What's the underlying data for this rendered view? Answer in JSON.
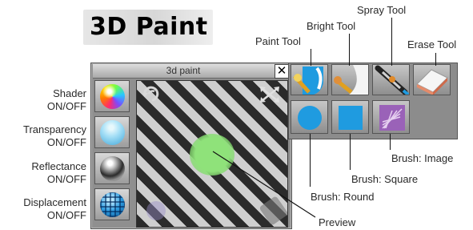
{
  "banner": {
    "title": "3D Paint"
  },
  "panel": {
    "title": "3d paint",
    "close_glyph": "✕"
  },
  "left_labels": [
    {
      "line1": "Shader",
      "line2": "ON/OFF"
    },
    {
      "line1": "Transparency",
      "line2": "ON/OFF"
    },
    {
      "line1": "Reflectance",
      "line2": "ON/OFF"
    },
    {
      "line1": "Displacement",
      "line2": "ON/OFF"
    }
  ],
  "tool_labels": {
    "paint": "Paint Tool",
    "bright": "Bright Tool",
    "spray": "Spray Tool",
    "erase": "Erase Tool"
  },
  "brush_labels": {
    "round": "Brush: Round",
    "square": "Brush: Square",
    "image": "Brush: Image"
  },
  "preview_label": "Preview",
  "icons": {
    "close": "close-icon",
    "rotate": "rotate-icon",
    "move": "move-arrows-icon",
    "paint": "paint-roller-icon",
    "bright": "bright-brush-icon",
    "spray": "airbrush-icon",
    "erase": "eraser-icon",
    "brush_round": "circle-icon",
    "brush_square": "square-icon",
    "brush_image": "image-brush-icon",
    "shader": "rainbow-sphere-icon",
    "transparency": "transparent-sphere-icon",
    "reflectance": "chrome-sphere-icon",
    "displacement": "grid-sphere-icon"
  },
  "colors": {
    "paint_blue": "#1f9be0",
    "preview_dot": "#7fd66a",
    "brush_image": "#9a62b8"
  }
}
